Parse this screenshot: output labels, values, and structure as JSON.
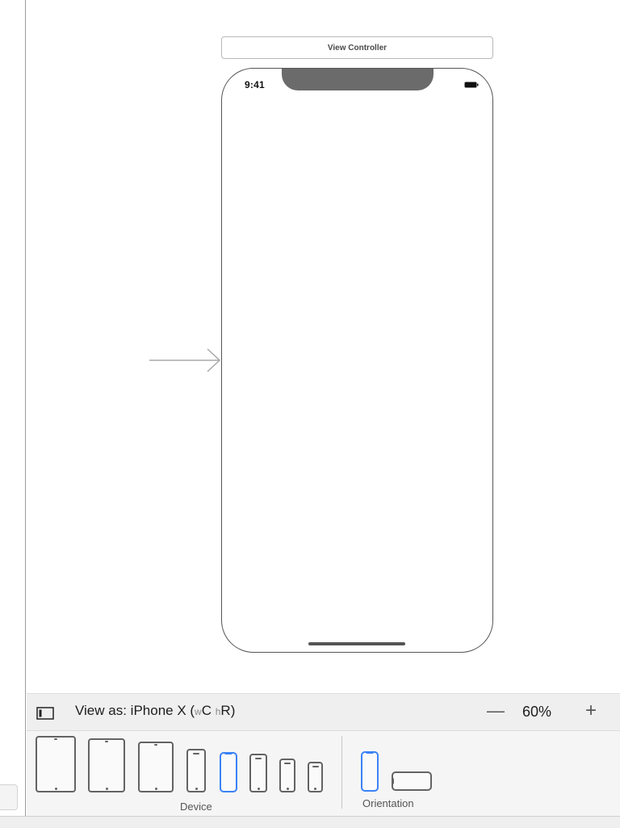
{
  "scene": {
    "title": "View Controller",
    "status_time": "9:41"
  },
  "view_as": {
    "label": "View as: iPhone X (",
    "size_class_w_prefix": "w",
    "size_class_w": "C",
    "size_class_h_prefix": "h",
    "size_class_h": "R",
    "closing": ")",
    "zoom_out": "—",
    "zoom": "60%",
    "zoom_in": "+"
  },
  "device_bar": {
    "device_label": "Device",
    "orientation_label": "Orientation",
    "selected_device": "iPhone X",
    "selected_orientation": "portrait"
  },
  "colors": {
    "accent": "#3b82f6",
    "device_stroke": "#636363",
    "bar_bg": "#efefef"
  }
}
